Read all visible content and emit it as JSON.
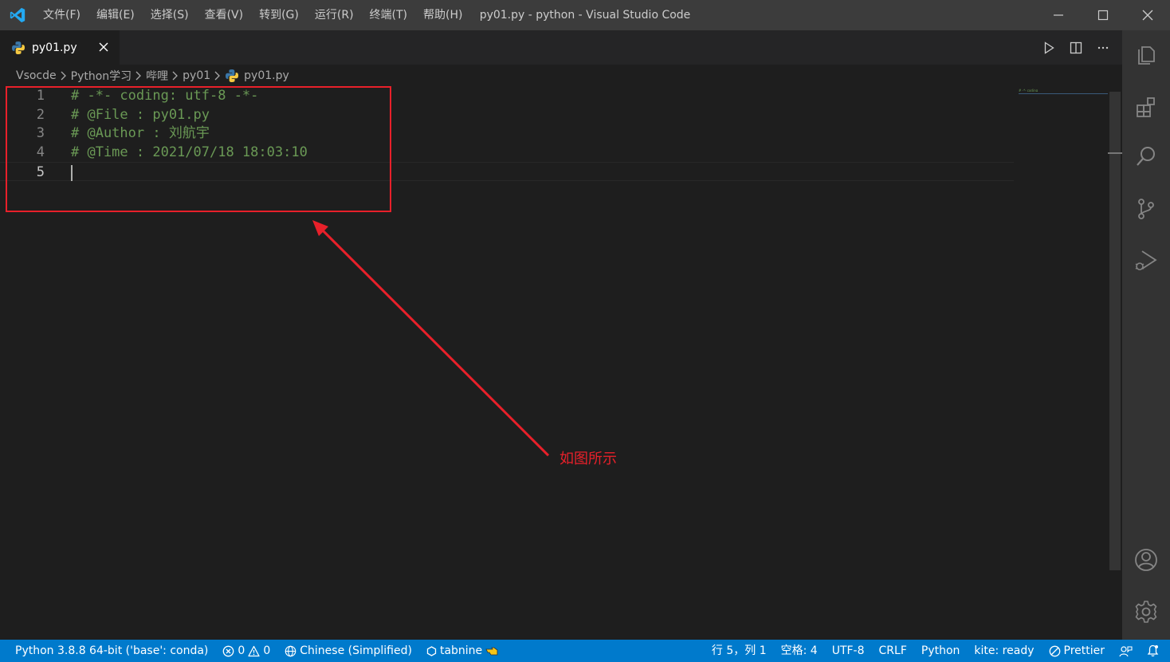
{
  "titlebar": {
    "menu": [
      "文件(F)",
      "编辑(E)",
      "选择(S)",
      "查看(V)",
      "转到(G)",
      "运行(R)",
      "终端(T)",
      "帮助(H)"
    ],
    "window_title": "py01.py - python - Visual Studio Code"
  },
  "tab": {
    "label": "py01.py"
  },
  "breadcrumb": [
    "Vsocde",
    "Python学习",
    "哔哩",
    "py01",
    "py01.py"
  ],
  "editor": {
    "lines": [
      {
        "number": "1",
        "text": "# -*- coding: utf-8 -*-"
      },
      {
        "number": "2",
        "text": "# @File : py01.py"
      },
      {
        "number": "3",
        "text": "# @Author : 刘航宇"
      },
      {
        "number": "4",
        "text": "# @Time : 2021/07/18 18:03:10"
      },
      {
        "number": "5",
        "text": ""
      }
    ],
    "minimap_text": "# -*- coding"
  },
  "annotation": {
    "text": "如图所示",
    "color": "#e8202a"
  },
  "statusbar": {
    "interpreter": "Python 3.8.8 64-bit ('base': conda)",
    "errors": "0",
    "warnings": "0",
    "language_pack": "Chinese (Simplified)",
    "tabnine": "tabnine",
    "position": "行 5，列 1",
    "indent": "空格: 4",
    "encoding": "UTF-8",
    "eol": "CRLF",
    "language": "Python",
    "kite": "kite: ready",
    "prettier": "Prettier"
  },
  "colors": {
    "titlebar": "#3c3c3c",
    "editor_bg": "#1e1e1e",
    "comment": "#6a9955",
    "statusbar": "#007acc",
    "activitybar": "#333333"
  },
  "icons": {
    "activitybar": [
      "explorer-icon",
      "extensions-icon",
      "search-icon",
      "source-control-icon",
      "run-debug-icon",
      "account-icon",
      "settings-gear-icon"
    ]
  }
}
